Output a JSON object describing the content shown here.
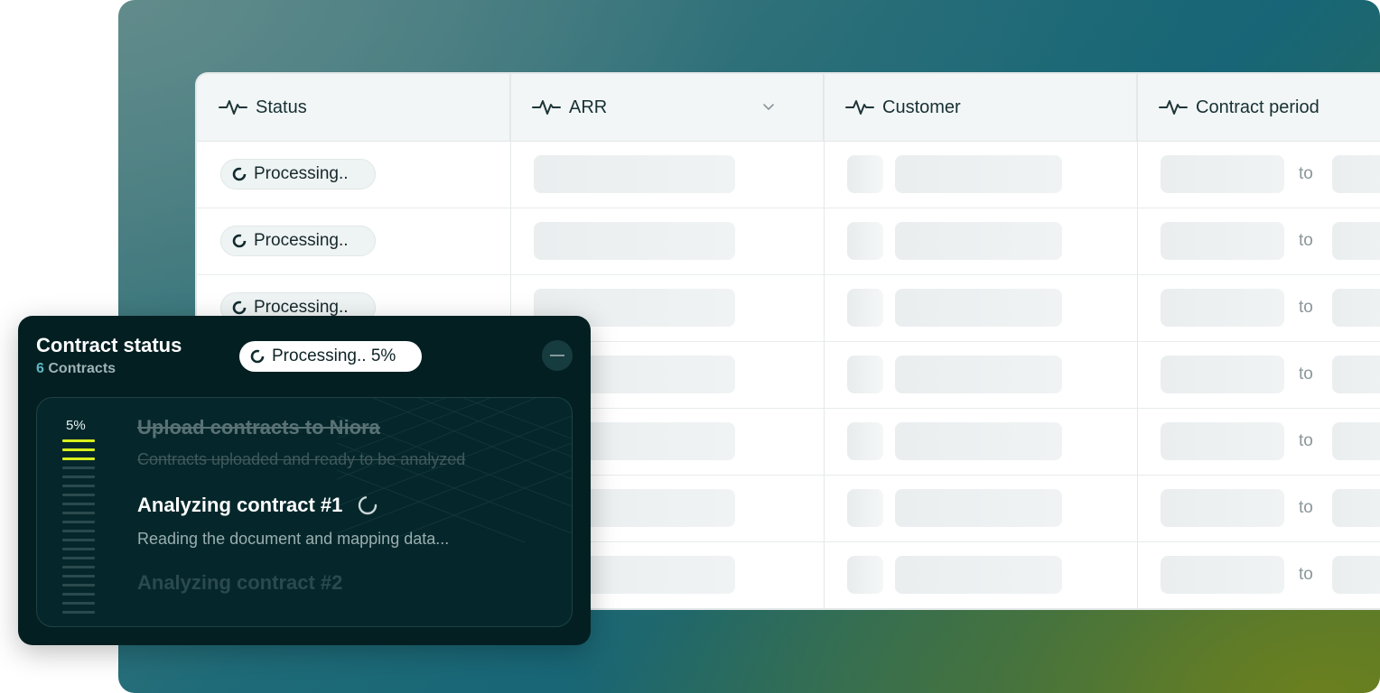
{
  "table": {
    "columns": [
      {
        "label": "Status",
        "icon": "pulse-icon"
      },
      {
        "label": "ARR",
        "icon": "pulse-icon",
        "sort_icon": "chevron-down-icon"
      },
      {
        "label": "Customer",
        "icon": "pulse-icon"
      },
      {
        "label": "Contract period",
        "icon": "pulse-icon"
      }
    ],
    "rows": [
      {
        "status": "Processing..",
        "period_sep": "to"
      },
      {
        "status": "Processing..",
        "period_sep": "to"
      },
      {
        "status": "Processing..",
        "period_sep": "to"
      },
      {
        "status": "",
        "period_sep": "to"
      },
      {
        "status": "",
        "period_sep": "to"
      },
      {
        "status": "",
        "period_sep": "to"
      },
      {
        "status": "",
        "period_sep": "to"
      }
    ]
  },
  "widget": {
    "title": "Contract status",
    "count": "6",
    "count_label": "Contracts",
    "pill": "Processing.. 5%",
    "minimize_symbol": "—",
    "progress_label": "5%",
    "progress_value": 0.05,
    "steps": [
      {
        "title": "Upload contracts to Niora",
        "desc": "Contracts uploaded and ready to be analyzed",
        "state": "done"
      },
      {
        "title": "Analyzing contract #1",
        "desc": "Reading the document and mapping data...",
        "state": "active"
      },
      {
        "title": "Analyzing contract #2",
        "desc": "",
        "state": "pending"
      }
    ]
  },
  "colors": {
    "accent": "#d8ef1a",
    "widget_bg": "#041f22",
    "header_bg": "#f2f6f6"
  }
}
